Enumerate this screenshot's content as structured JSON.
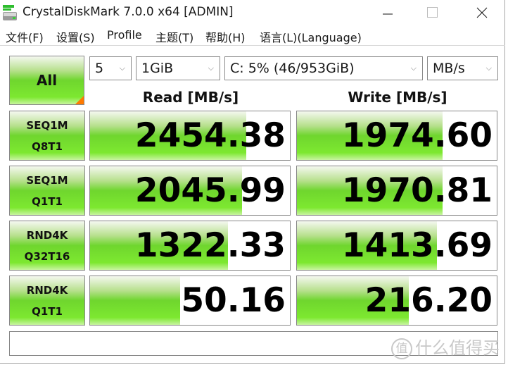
{
  "window": {
    "title": "CrystalDiskMark 7.0.0 x64 [ADMIN]",
    "controls": {
      "minimize": "—",
      "maximize": "☐",
      "close": "✕"
    }
  },
  "menu": [
    "文件(F)",
    "设置(S)",
    "Profile",
    "主题(T)",
    "帮助(H)",
    "语言(L)(Language)"
  ],
  "toolbar": {
    "all_label": "All",
    "count": "5",
    "size": "1GiB",
    "drive": "C: 5% (46/953GiB)",
    "unit": "MB/s",
    "chevron": "⌵"
  },
  "headers": {
    "read": "Read [MB/s]",
    "write": "Write [MB/s]"
  },
  "tests": [
    {
      "line1": "SEQ1M",
      "line2": "Q8T1",
      "read": "2454.38",
      "write": "1974.60",
      "read_fill": 0.78,
      "write_fill": 0.73
    },
    {
      "line1": "SEQ1M",
      "line2": "Q1T1",
      "read": "2045.99",
      "write": "1970.81",
      "read_fill": 0.76,
      "write_fill": 0.73
    },
    {
      "line1": "RND4K",
      "line2": "Q32T16",
      "read": "1322.33",
      "write": "1413.69",
      "read_fill": 0.69,
      "write_fill": 0.7
    },
    {
      "line1": "RND4K",
      "line2": "Q1T1",
      "read": "50.16",
      "write": "216.20",
      "read_fill": 0.45,
      "write_fill": 0.56
    }
  ],
  "comment": "",
  "watermark": {
    "badge": "值",
    "text": "什么值得买"
  },
  "colors": {
    "accent_green": "#6fd62e",
    "corner_orange": "#ff7a00"
  }
}
